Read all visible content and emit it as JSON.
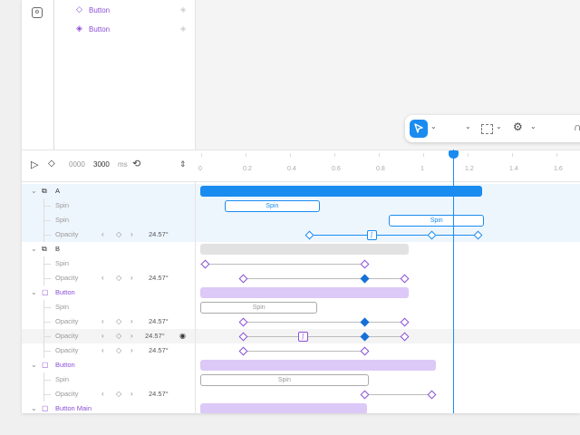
{
  "layers": [
    {
      "label": "Button"
    },
    {
      "label": "Button"
    }
  ],
  "toolbar": {
    "chev": "⌄"
  },
  "header": {
    "play": "▷",
    "keyframe": "◇",
    "start_time": "0000",
    "end_time": "3000",
    "unit": "ms",
    "loop": "⟲",
    "collapse": "⇕"
  },
  "ruler": {
    "ticks": [
      "0",
      "0.2",
      "0.4",
      "0.6",
      "0.8",
      "1",
      "1.2",
      "1.4",
      "1.6"
    ]
  },
  "rows": [
    {
      "type": "group",
      "label": "A"
    },
    {
      "type": "anim",
      "label": "Spin",
      "clip": "Spin"
    },
    {
      "type": "anim",
      "label": "Spin",
      "clip": "Spin"
    },
    {
      "type": "prop",
      "label": "Opacity",
      "value": "24.57°"
    },
    {
      "type": "group",
      "label": "B"
    },
    {
      "type": "anim",
      "label": "Spin"
    },
    {
      "type": "prop",
      "label": "Opacity",
      "value": "24.57°"
    },
    {
      "type": "group",
      "label": "Button"
    },
    {
      "type": "anim",
      "label": "Spin",
      "clip": "Spin"
    },
    {
      "type": "prop",
      "label": "Opacity",
      "value": "24.57°"
    },
    {
      "type": "prop",
      "label": "Opacity",
      "value": "24.57°"
    },
    {
      "type": "prop",
      "label": "Opacity",
      "value": "24.57°"
    },
    {
      "type": "group",
      "label": "Button"
    },
    {
      "type": "anim",
      "label": "Spin",
      "clip": "Spin"
    },
    {
      "type": "prop",
      "label": "Opacity",
      "value": "24.57°"
    },
    {
      "type": "group",
      "label": "Button Main"
    }
  ],
  "colors": {
    "accent": "#1a8cf0",
    "purple": "#8a4fd6",
    "purple_bar": "#dcc9f7",
    "gray_bar": "#e2e2e2"
  }
}
